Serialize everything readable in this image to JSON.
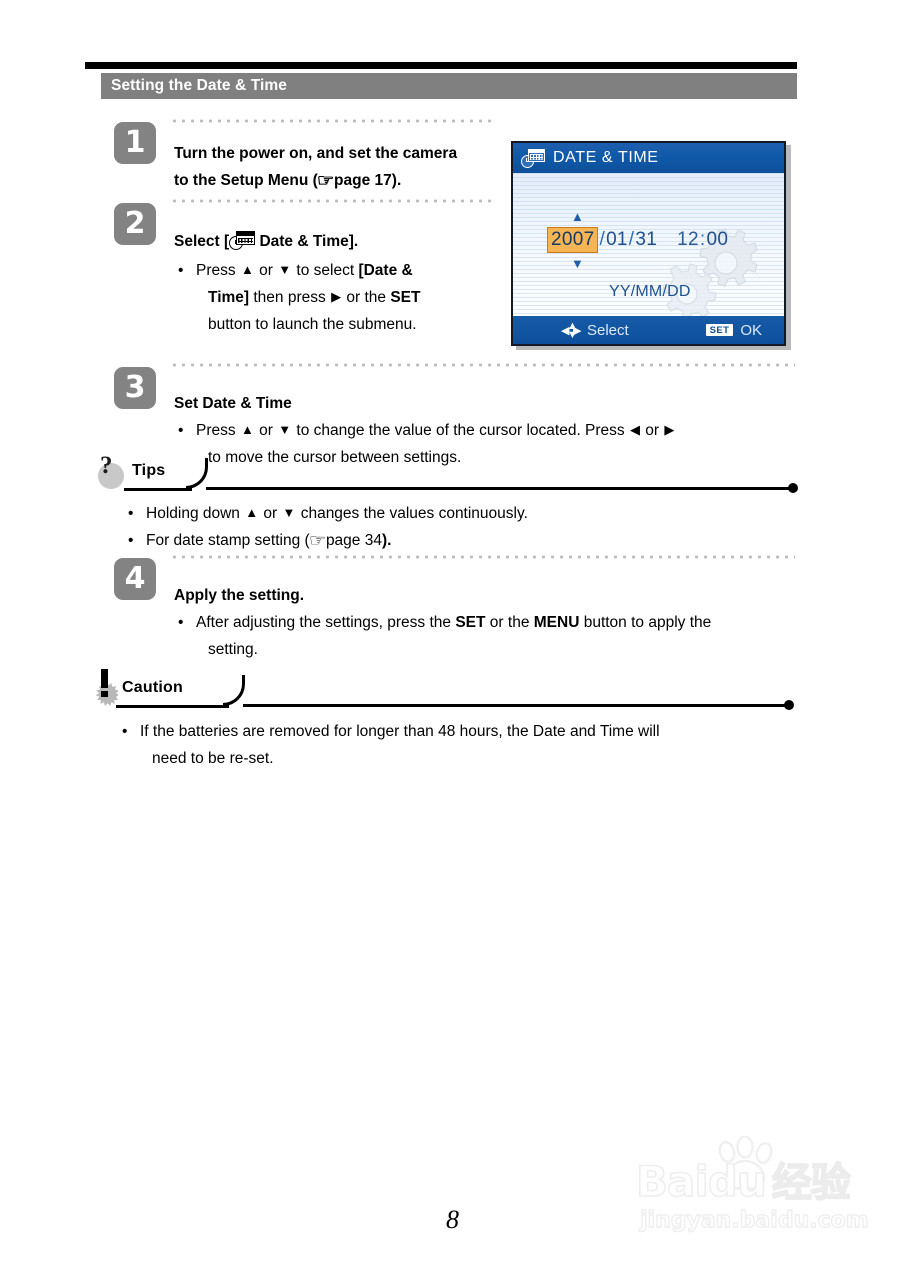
{
  "page": {
    "section_title": "Setting the Date & Time",
    "page_number": "8"
  },
  "steps": [
    {
      "number": "1",
      "title_line1": "Turn the power on, and set the camera",
      "title_line2_pre": "to the Setup Menu (",
      "title_line2_ref": "page 17",
      "title_line2_post": ")."
    },
    {
      "number": "2",
      "title_pre": "Select [",
      "title_post": " Date & Time].",
      "bullet1_a": "Press ",
      "bullet1_up": "▲",
      "bullet1_b": " or ",
      "bullet1_down": "▼",
      "bullet1_c": " to select ",
      "bullet1_bold1": "[Date &",
      "bullet1_bold2": "Time]",
      "bullet1_d": " then press ",
      "bullet1_right": "▶",
      "bullet1_e": " or the ",
      "bullet1_bold3": "SET",
      "bullet1_f": "button to launch the submenu."
    },
    {
      "number": "3",
      "title": "Set Date & Time",
      "bullet1_a": "Press ",
      "bullet1_up": "▲",
      "bullet1_b": " or ",
      "bullet1_down": "▼",
      "bullet1_c": " to change the value of the cursor located. Press ",
      "bullet1_left": "◀",
      "bullet1_d": " or ",
      "bullet1_right": "▶",
      "bullet1_e": "to move the cursor between settings."
    },
    {
      "number": "4",
      "title": "Apply the setting.",
      "bullet1_a": "After adjusting the settings, press the ",
      "bullet1_bold1": "SET",
      "bullet1_b": " or the ",
      "bullet1_bold2": "MENU",
      "bullet1_c": " button to apply the",
      "bullet1_d": "setting."
    }
  ],
  "tips": {
    "label": "Tips",
    "icon": "question-mark-icon",
    "bullets": [
      {
        "a": "Holding down ",
        "up": "▲",
        "b": " or ",
        "down": "▼",
        "c": " changes the values continuously."
      },
      {
        "a": "For date stamp setting (",
        "ref": "page 34",
        "c": ")."
      }
    ]
  },
  "caution": {
    "label": "Caution",
    "icon": "warning-burst-icon",
    "bullet_line1": "If the batteries are removed for longer than 48 hours, the Date and Time will",
    "bullet_line2": "need to be re-set."
  },
  "lcd": {
    "title": "DATE & TIME",
    "title_icon": "calendar-clock-icon",
    "year": "2007",
    "sep1": "/",
    "month": "01",
    "sep2": "/",
    "day": "31",
    "hour": "12",
    "time_sep": ":",
    "minute": "00",
    "format_label": "YY/MM/DD",
    "up_indicator": "▲",
    "down_indicator": "▼",
    "footer_select": "Select",
    "footer_set_chip": "SET",
    "footer_ok": "OK",
    "colors": {
      "titlebar": "#0f59a8",
      "highlight": "#f5b555",
      "highlight_border": "#cf7a18",
      "text": "#1e4f8c"
    }
  },
  "watermark": {
    "main": "Baidu",
    "cn": "经验",
    "sub": "jingyan.baidu.com"
  }
}
